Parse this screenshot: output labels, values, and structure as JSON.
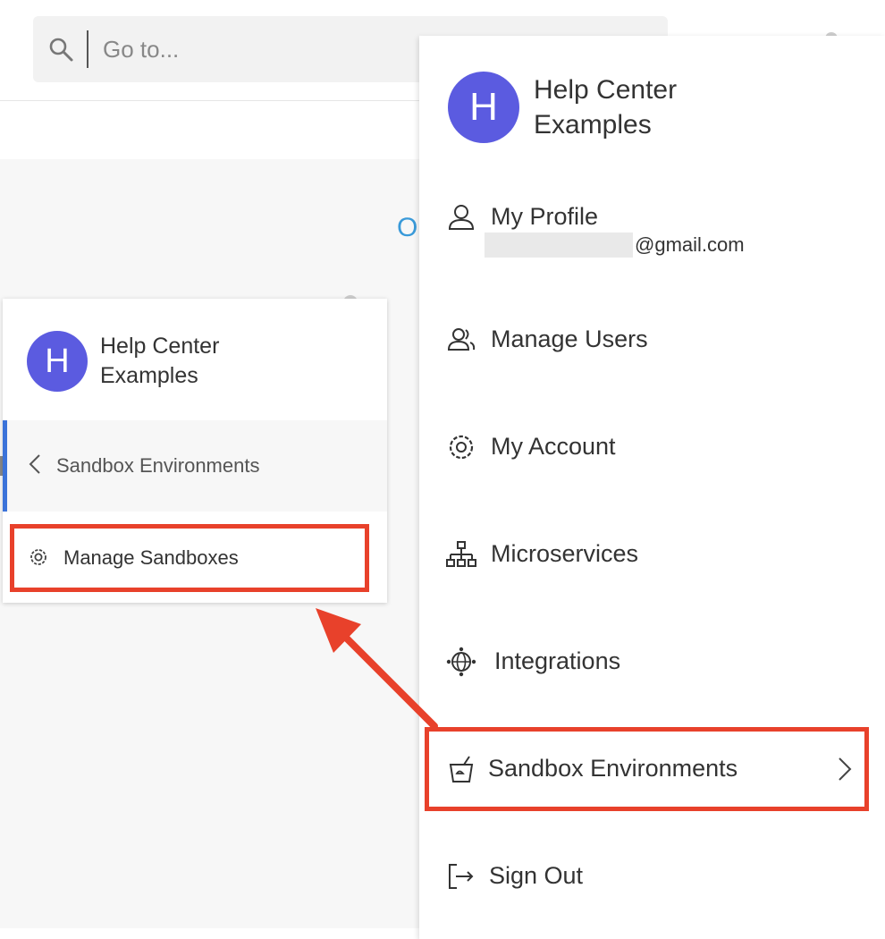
{
  "search": {
    "placeholder": "Go to...",
    "icon": "search-icon"
  },
  "background": {
    "peek_letter": "O"
  },
  "submenu_card": {
    "org": {
      "avatar_letter": "H",
      "name_line1": "Help Center",
      "name_line2": "Examples"
    },
    "back_label": "Sandbox Environments",
    "items": [
      {
        "label": "Manage Sandboxes",
        "icon": "gear-icon"
      }
    ]
  },
  "account_menu": {
    "org": {
      "avatar_letter": "H",
      "name_line1": "Help Center",
      "name_line2": "Examples"
    },
    "items": [
      {
        "label": "My Profile",
        "icon": "user-icon",
        "sub": "@gmail.com"
      },
      {
        "label": "Manage Users",
        "icon": "users-icon"
      },
      {
        "label": "My Account",
        "icon": "gear-icon"
      },
      {
        "label": "Microservices",
        "icon": "sitemap-icon"
      },
      {
        "label": "Integrations",
        "icon": "globe-network-icon"
      },
      {
        "label": "Sandbox Environments",
        "icon": "sandbox-bucket-icon",
        "has_submenu": true
      },
      {
        "label": "Sign Out",
        "icon": "sign-out-icon"
      }
    ]
  },
  "colors": {
    "avatar": "#5b5be0",
    "highlight": "#e8412b",
    "active_border": "#3b73d9",
    "link": "#3a9ad9"
  }
}
